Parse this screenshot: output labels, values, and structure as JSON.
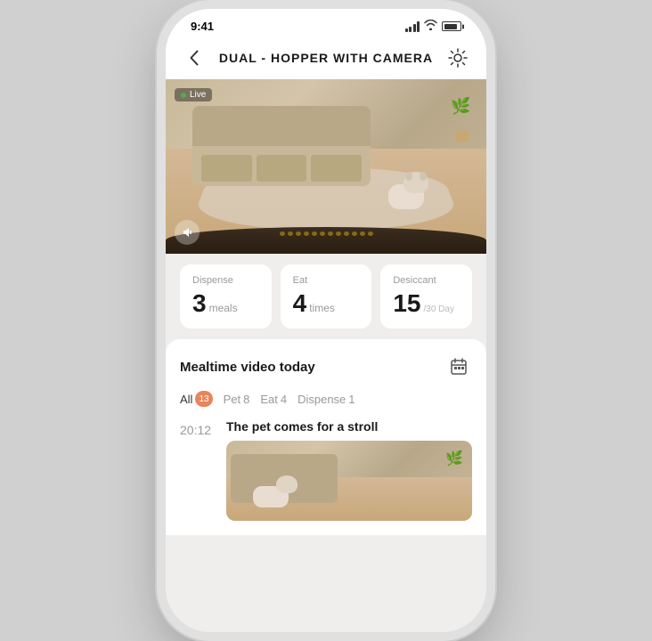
{
  "statusBar": {
    "time": "9:41",
    "battery": 85
  },
  "header": {
    "title": "DUAL - HOPPER WITH CAMERA",
    "backLabel": "‹",
    "settingsLabel": "⊙"
  },
  "camera": {
    "liveBadge": "Live"
  },
  "stats": [
    {
      "label": "Dispense",
      "number": "3",
      "unit": "meals",
      "unitSmall": ""
    },
    {
      "label": "Eat",
      "number": "4",
      "unit": "times",
      "unitSmall": ""
    },
    {
      "label": "Desiccant",
      "number": "15",
      "unit": "/30 Day",
      "unitSmall": ""
    }
  ],
  "mealtimeSection": {
    "title": "Mealtime video today",
    "filters": [
      {
        "label": "All",
        "count": "13",
        "active": true
      },
      {
        "label": "Pet",
        "count": "8",
        "active": false
      },
      {
        "label": "Eat",
        "count": "4",
        "active": false
      },
      {
        "label": "Dispense",
        "count": "1",
        "active": false
      }
    ],
    "videos": [
      {
        "time": "20:12",
        "title": "The pet comes for a stroll"
      }
    ]
  }
}
